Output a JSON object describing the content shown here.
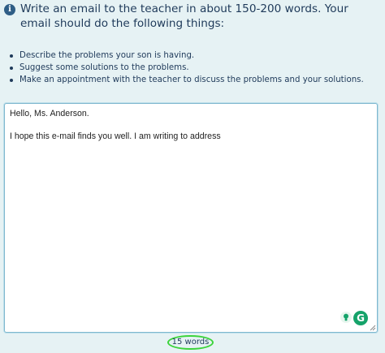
{
  "prompt": {
    "info_icon": "i",
    "title": "Write an email to the teacher in about 150-200 words. Your email should do the following things:",
    "bullets": [
      "Describe the problems your son is having.",
      "Suggest some solutions to the problems.",
      "Make an appointment with the teacher to discuss the problems and your solutions."
    ]
  },
  "editor": {
    "value": "Hello, Ms. Anderson.\n\nI hope this e-mail finds you well. I am writing to address",
    "assist_icon": "lightbulb-icon",
    "grammarly_icon": "G"
  },
  "word_count": "15 words",
  "colors": {
    "background": "#e6f2f4",
    "title_text": "#1f3a5a",
    "grammarly_green": "#15a36a",
    "highlight_circle": "#3cd43c"
  }
}
